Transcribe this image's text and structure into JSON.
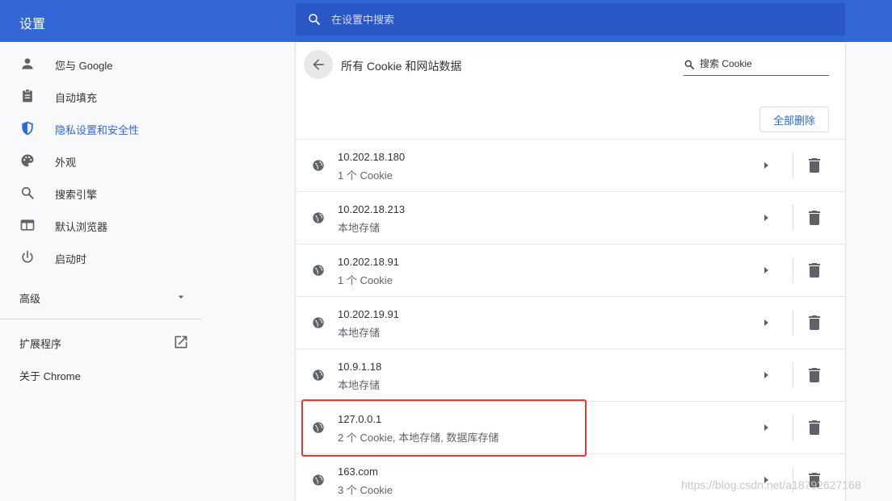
{
  "header": {
    "title": "设置",
    "search_placeholder": "在设置中搜索"
  },
  "sidebar": {
    "items": [
      {
        "label": "您与 Google",
        "icon": "person-icon"
      },
      {
        "label": "自动填充",
        "icon": "clipboard-icon"
      },
      {
        "label": "隐私设置和安全性",
        "icon": "shield-icon",
        "active": true
      },
      {
        "label": "外观",
        "icon": "palette-icon"
      },
      {
        "label": "搜索引擎",
        "icon": "search-icon"
      },
      {
        "label": "默认浏览器",
        "icon": "browser-window-icon"
      },
      {
        "label": "启动时",
        "icon": "power-icon"
      }
    ],
    "advanced_label": "高级",
    "extensions_label": "扩展程序",
    "about_label": "关于 Chrome"
  },
  "subpage": {
    "title": "所有 Cookie 和网站数据",
    "search_placeholder": "搜索 Cookie",
    "remove_all_label": "全部删除"
  },
  "sites": [
    {
      "host": "10.202.18.180",
      "desc": "1 个 Cookie"
    },
    {
      "host": "10.202.18.213",
      "desc": "本地存储"
    },
    {
      "host": "10.202.18.91",
      "desc": "1 个 Cookie"
    },
    {
      "host": "10.202.19.91",
      "desc": "本地存储"
    },
    {
      "host": "10.9.1.18",
      "desc": "本地存储"
    },
    {
      "host": "127.0.0.1",
      "desc": "2 个 Cookie, 本地存储, 数据库存储"
    },
    {
      "host": "163.com",
      "desc": "3 个 Cookie"
    }
  ],
  "watermark": "https://blog.csdn.net/a18792627168",
  "colors": {
    "header_bg": "#3367d6",
    "search_bg": "#2a56c6",
    "accent": "#3367d6",
    "highlight_border": "#e53935"
  }
}
